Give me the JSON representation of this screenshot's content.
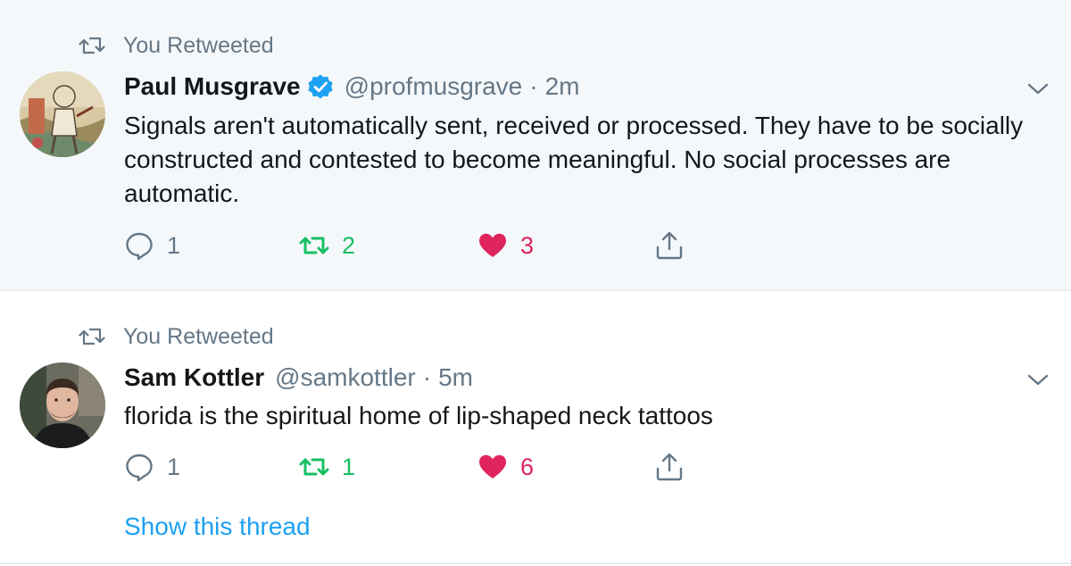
{
  "tweets": [
    {
      "retweet_label": "You Retweeted",
      "author_name": "Paul Musgrave",
      "verified": true,
      "handle": "@profmusgrave",
      "separator": "·",
      "time": "2m",
      "text": "Signals aren't automatically sent, received or processed. They have to be socially constructed and contested to become meaningful. No social processes are automatic.",
      "replies": "1",
      "retweets": "2",
      "likes": "3",
      "retweeted_by_me": true,
      "liked_by_me": true
    },
    {
      "retweet_label": "You Retweeted",
      "author_name": "Sam Kottler",
      "verified": false,
      "handle": "@samkottler",
      "separator": "·",
      "time": "5m",
      "text": "florida is the spiritual home of lip-shaped neck tattoos",
      "replies": "1",
      "retweets": "1",
      "likes": "6",
      "retweeted_by_me": true,
      "liked_by_me": true,
      "show_thread_label": "Show this thread"
    }
  ],
  "colors": {
    "accent": "#1da1f2",
    "retweet_active": "#17bf63",
    "like_active": "#e0245e",
    "muted": "#657786",
    "highlight_bg": "#f5f8fa"
  }
}
